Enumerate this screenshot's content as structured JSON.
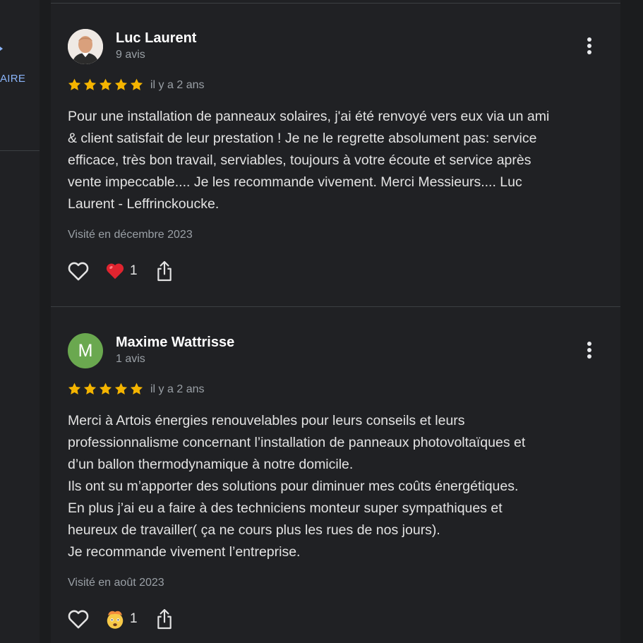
{
  "left_panel": {
    "label": "AIRE"
  },
  "reviews": [
    {
      "author": "Luc Laurent",
      "author_meta": "9 avis",
      "rating": 5,
      "time": "il y a 2 ans",
      "text": "Pour une installation de panneaux solaires, j'ai été renvoyé vers eux via un ami\n& client satisfait de leur prestation ! Je ne le regrette absolument pas: service\nefficace, très bon travail, serviables, toujours à votre écoute et service après\nvente impeccable.... Je les recommande vivement. Merci Messieurs.... Luc\nLaurent - Leffrinckoucke.",
      "visited": "Visité en décembre 2023",
      "reaction_icon": "red-heart-emoji",
      "reaction_count": "1"
    },
    {
      "author": "Maxime Wattrisse",
      "author_initial": "M",
      "author_meta": "1 avis",
      "rating": 5,
      "time": "il y a 2 ans",
      "text": "Merci à Artois énergies renouvelables pour leurs conseils et leurs\nprofessionnalisme concernant l’installation de panneaux photovoltaïques et\nd’un ballon thermodynamique à notre domicile.\nIls ont su m’apporter des solutions pour diminuer mes coûts énergétiques.\nEn plus j’ai eu a faire à des techniciens monteur super sympathiques et\nheureux de travailler( ça ne cours plus les rues de nos jours).\nJe recommande vivement l’entreprise.",
      "visited": "Visité en août 2023",
      "reaction_icon": "exploding-head-emoji",
      "reaction_count": "1"
    }
  ],
  "colors": {
    "star": "#f4b400",
    "background": "#202124",
    "text": "#e3e3e3",
    "muted": "#9aa0a6",
    "accent": "#8ab4f8"
  }
}
